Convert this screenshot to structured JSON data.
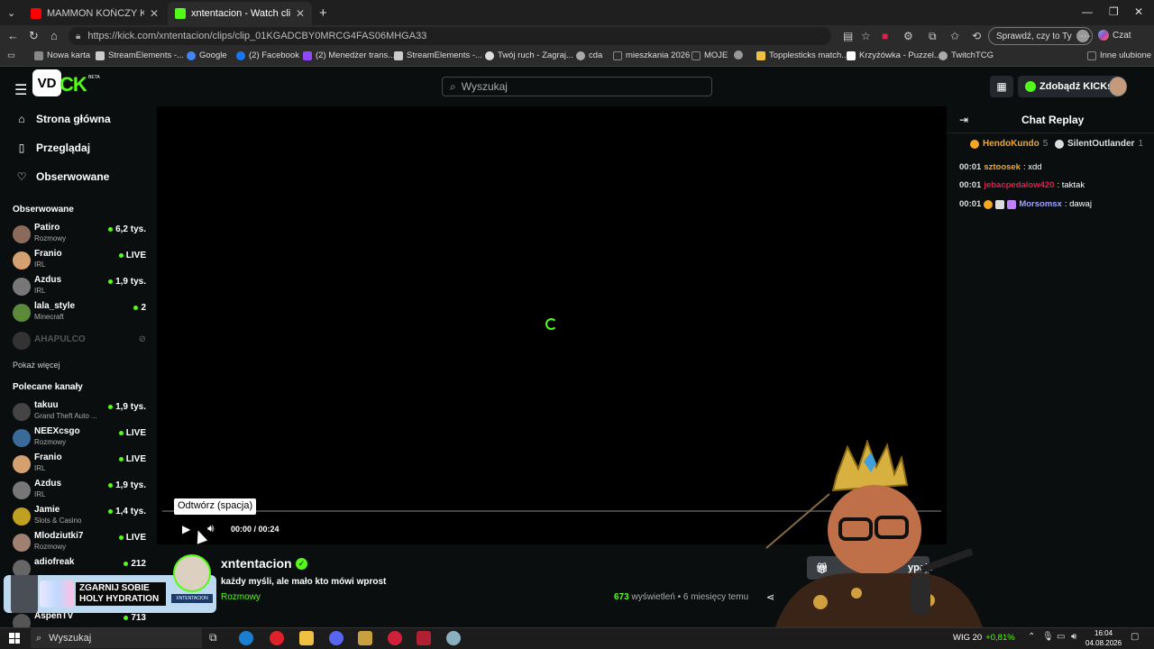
{
  "browser": {
    "tabs": [
      {
        "title": "MAMMON KOŃCZY KARIERĘ!? Al",
        "active": false,
        "favicon_color": "#ff0000"
      },
      {
        "title": "xntentacion - Watch clips on Kick",
        "active": true,
        "favicon_color": "#53fc18"
      }
    ],
    "url": "https://kick.com/xntentacion/clips/clip_01KGADCBY0MRCG4FAS06MHGA33",
    "check_button": "Sprawdź, czy to Ty",
    "chat_button": "Czat",
    "bookmarks": [
      {
        "label": "Nowa karta",
        "color": "#888"
      },
      {
        "label": "StreamElements -...",
        "color": "#ccc"
      },
      {
        "label": "Google",
        "color": "#4285f4"
      },
      {
        "label": "(2) Facebook",
        "color": "#1877f2"
      },
      {
        "label": "(2) Menedżer trans...",
        "color": "#9146ff"
      },
      {
        "label": "StreamElements -...",
        "color": "#ccc"
      },
      {
        "label": "Twój ruch - Zagraj...",
        "color": "#ddd"
      },
      {
        "label": "cda",
        "color": "#aaa"
      },
      {
        "label": "mieszkania 2026",
        "color": "#888"
      },
      {
        "label": "MOJE",
        "color": "#888"
      },
      {
        "label": "",
        "color": "#999"
      },
      {
        "label": "Topplesticks match...",
        "color": "#f0c040"
      },
      {
        "label": "Krzyżówka - Puzzel...",
        "color": "#fff"
      },
      {
        "label": "TwitchTCG",
        "color": "#aaa"
      }
    ],
    "other_bookmarks": "Inne ulubione"
  },
  "header": {
    "logo_badge": "VD",
    "logo_text": "CK",
    "logo_beta": "BETA",
    "search_placeholder": "Wyszukaj",
    "kicks_button": "Zdobądź KICKs"
  },
  "sidebar": {
    "nav": [
      {
        "label": "Strona główna",
        "icon": "home-icon"
      },
      {
        "label": "Przeglądaj",
        "icon": "browse-icon"
      },
      {
        "label": "Obserwowane",
        "icon": "heart-icon"
      }
    ],
    "followed_title": "Obserwowane",
    "followed": [
      {
        "name": "Patiro",
        "category": "Rozmowy",
        "viewers": "6,2 tys.",
        "color": "#8a6a5a"
      },
      {
        "name": "Franio",
        "category": "IRL",
        "viewers": "LIVE",
        "color": "#d4a070"
      },
      {
        "name": "Azdus",
        "category": "IRL",
        "viewers": "1,9 tys.",
        "color": "#777"
      },
      {
        "name": "lala_style",
        "category": "Minecraft",
        "viewers": "2",
        "color": "#5a8a3a"
      },
      {
        "name": "AHAPULCO",
        "category": "",
        "viewers": "",
        "color": "#333"
      }
    ],
    "show_more": "Pokaż więcej",
    "recommended_title": "Polecane kanały",
    "recommended": [
      {
        "name": "takuu",
        "category": "Grand Theft Auto ...",
        "viewers": "1,9 tys.",
        "color": "#444"
      },
      {
        "name": "NEEXcsgo",
        "category": "Rozmowy",
        "viewers": "LIVE",
        "color": "#3a6a9a"
      },
      {
        "name": "Franio",
        "category": "IRL",
        "viewers": "LIVE",
        "color": "#d4a070"
      },
      {
        "name": "Azdus",
        "category": "IRL",
        "viewers": "1,9 tys.",
        "color": "#777"
      },
      {
        "name": "Jamie",
        "category": "Slots & Casino",
        "viewers": "1,4 tys.",
        "color": "#c0a020"
      },
      {
        "name": "Mlodziutki7",
        "category": "Rozmowy",
        "viewers": "LIVE",
        "color": "#a08070"
      },
      {
        "name": "adiofreak",
        "category": "",
        "viewers": "212",
        "color": "#666"
      },
      {
        "name": "AspenTV",
        "category": "",
        "viewers": "713",
        "color": "#555"
      }
    ],
    "ad": {
      "headline": "ZGARNIJ SOBIE HOLY HYDRATION",
      "tag": "XNTENTACION"
    }
  },
  "player": {
    "tooltip": "Odtwórz (spacja)",
    "current_time": "00:00",
    "duration": "00:24",
    "progress": 0
  },
  "clip": {
    "channel": "xntentacion",
    "title": "każdy myśli, ale mało kto mówi wprost",
    "category": "Rozmowy",
    "views": "673",
    "views_label": "wyświetleń",
    "age": "6 miesięcy temu",
    "subscribe_partial": "ypcje"
  },
  "chat": {
    "title": "Chat Replay",
    "gifters": [
      {
        "name": "HendoKundo",
        "count": "5",
        "color": "#f5a623"
      },
      {
        "name": "SilentOutlander",
        "count": "1",
        "color": "#ddd"
      }
    ],
    "messages": [
      {
        "time": "00:01",
        "user": "sztoosek",
        "text": ": xdd",
        "color": "#f5a623",
        "badges": []
      },
      {
        "time": "00:01",
        "user": "jebacpedalow420",
        "text": ": taktak",
        "color": "#e0204a",
        "badges": []
      },
      {
        "time": "00:01",
        "user": "Morsomsx",
        "text": ": dawaj",
        "color": "#a0a0ff",
        "badges": [
          "#f5a623",
          "#ddd",
          "#c080ff"
        ]
      }
    ]
  },
  "taskbar": {
    "search": "Wyszukaj",
    "stock_name": "WIG 20",
    "stock_change": "+0,81%",
    "time": "16:04",
    "date": "04.08.2026"
  }
}
